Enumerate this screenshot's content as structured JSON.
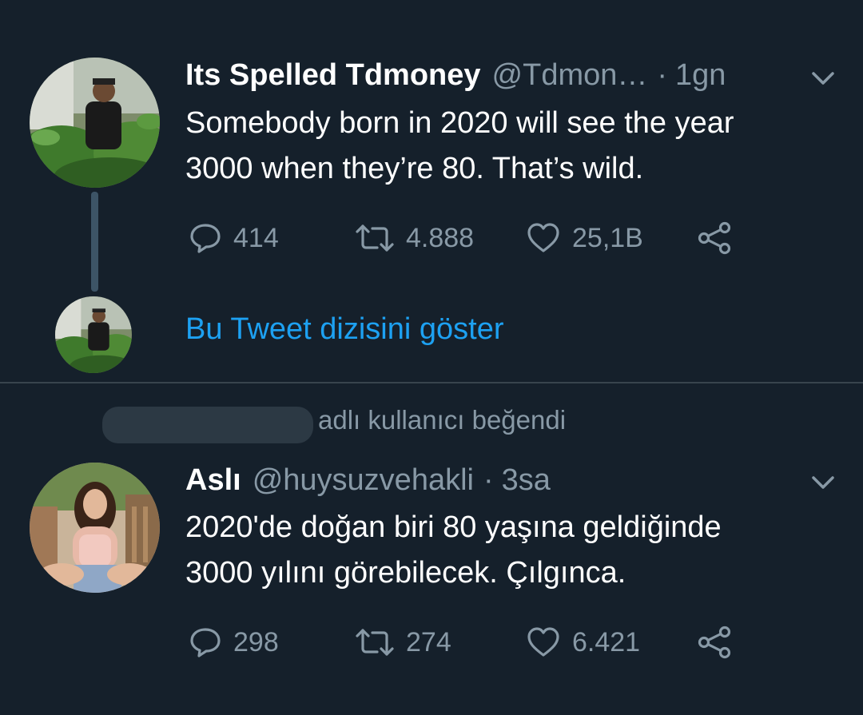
{
  "tweets": [
    {
      "author_name": "Its Spelled Tdmoney",
      "handle": "@Tdmon…",
      "separator": "·",
      "time": "1gn",
      "text_lines": [
        "Somebody born in 2020 will see the year",
        "3000 when they’re 80. That’s wild."
      ],
      "replies": "414",
      "retweets": "4.888",
      "likes": "25,1B"
    },
    {
      "author_name": "Aslı",
      "handle": "@huysuzvehakli",
      "separator": "·",
      "time": "3sa",
      "text_lines": [
        "2020'de doğan biri 80 yaşına geldiğinde",
        "3000 yılını görebilecek. Çılgınca."
      ],
      "replies": "298",
      "retweets": "274",
      "likes": "6.421"
    }
  ],
  "show_thread_label": "Bu Tweet dizisini göster",
  "liked_by_text": "adlı kullanıcı beğendi",
  "colors": {
    "background": "#15202b",
    "primary_text": "#ffffff",
    "secondary_text": "#8899a6",
    "link": "#1da1f2",
    "divider": "#38444d"
  },
  "icons": [
    "reply-icon",
    "retweet-icon",
    "like-icon",
    "share-icon",
    "chevron-down-icon"
  ]
}
